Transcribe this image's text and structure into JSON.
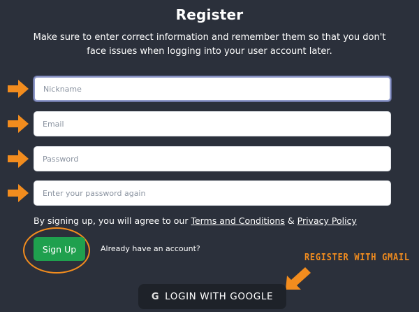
{
  "header": {
    "title": "Register",
    "subtitle": "Make sure to enter correct information and remember them so that you don't face issues when logging into your user account later."
  },
  "form": {
    "nickname_placeholder": "Nickname",
    "email_placeholder": "Email",
    "password_placeholder": "Password",
    "password_confirm_placeholder": "Enter your password again"
  },
  "terms": {
    "prefix": "By signing up, you will agree to our ",
    "terms_link": "Terms and Conditions",
    "joiner": " & ",
    "privacy_link": "Privacy Policy"
  },
  "actions": {
    "signup_label": "Sign Up",
    "already_text": "Already have an account?",
    "google_label": "LOGIN WITH GOOGLE",
    "google_icon": "G"
  },
  "annotation": {
    "text": "REGISTER WITH GMAIL",
    "color": "#f28c1e"
  },
  "colors": {
    "background": "#2b303b",
    "accent_green": "#1fa04e",
    "annotation_orange": "#f28c1e"
  }
}
